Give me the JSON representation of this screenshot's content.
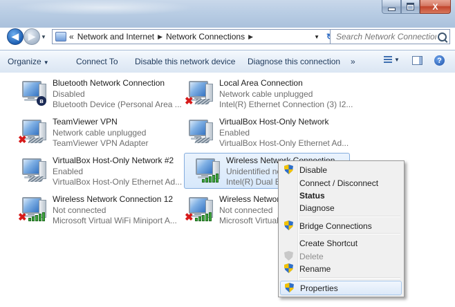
{
  "window": {
    "buttons": {
      "minimize": "–",
      "maximize": "□",
      "close": "X"
    }
  },
  "address": {
    "overflow": "«",
    "crumbs": [
      "Network and Internet",
      "Network Connections"
    ],
    "separator": "▶",
    "search_placeholder": "Search Network Connections"
  },
  "toolbar": {
    "organize": "Organize",
    "connect_to": "Connect To",
    "disable": "Disable this network device",
    "diagnose": "Diagnose this connection",
    "more": "»"
  },
  "connections": [
    {
      "name": "Bluetooth Network Connection",
      "status": "Disabled",
      "device": "Bluetooth Device (Personal Area ...",
      "badge": "bluetooth"
    },
    {
      "name": "Local Area Connection",
      "status": "Network cable unplugged",
      "device": "Intel(R) Ethernet Connection (3) I2...",
      "badge": "unplugged"
    },
    {
      "name": "TeamViewer VPN",
      "status": "Network cable unplugged",
      "device": "TeamViewer VPN Adapter",
      "badge": "unplugged"
    },
    {
      "name": "VirtualBox Host-Only Network",
      "status": "Enabled",
      "device": "VirtualBox Host-Only Ethernet Ad...",
      "badge": "cable"
    },
    {
      "name": "VirtualBox Host-Only Network #2",
      "status": "Enabled",
      "device": "VirtualBox Host-Only Ethernet Ad...",
      "badge": "cable"
    },
    {
      "name": "Wireless Network Connection",
      "status": "Unidentified netw",
      "device": "Intel(R) Dual Ban",
      "badge": "wifi"
    },
    {
      "name": "Wireless Network Connection 12",
      "status": "Not connected",
      "device": "Microsoft Virtual WiFi Miniport A...",
      "badge": "wifi-off"
    },
    {
      "name": "Wireless Network",
      "status": "Not connected",
      "device": "Microsoft Virtual",
      "badge": "wifi-off"
    }
  ],
  "context_menu": {
    "items": [
      {
        "label": "Disable",
        "shield": true
      },
      {
        "label": "Connect / Disconnect"
      },
      {
        "label": "Status",
        "bold": true
      },
      {
        "label": "Diagnose"
      },
      {
        "label": "Bridge Connections",
        "shield": true
      },
      {
        "label": "Create Shortcut"
      },
      {
        "label": "Delete",
        "shield": true,
        "disabled": true
      },
      {
        "label": "Rename",
        "shield": true
      },
      {
        "label": "Properties",
        "shield": true,
        "hovered": true
      }
    ]
  },
  "colors": {
    "accent": "#1e395b",
    "error_x": "#d61a1a",
    "signal": "#3ea63e",
    "selection": "#d7e8fb"
  }
}
